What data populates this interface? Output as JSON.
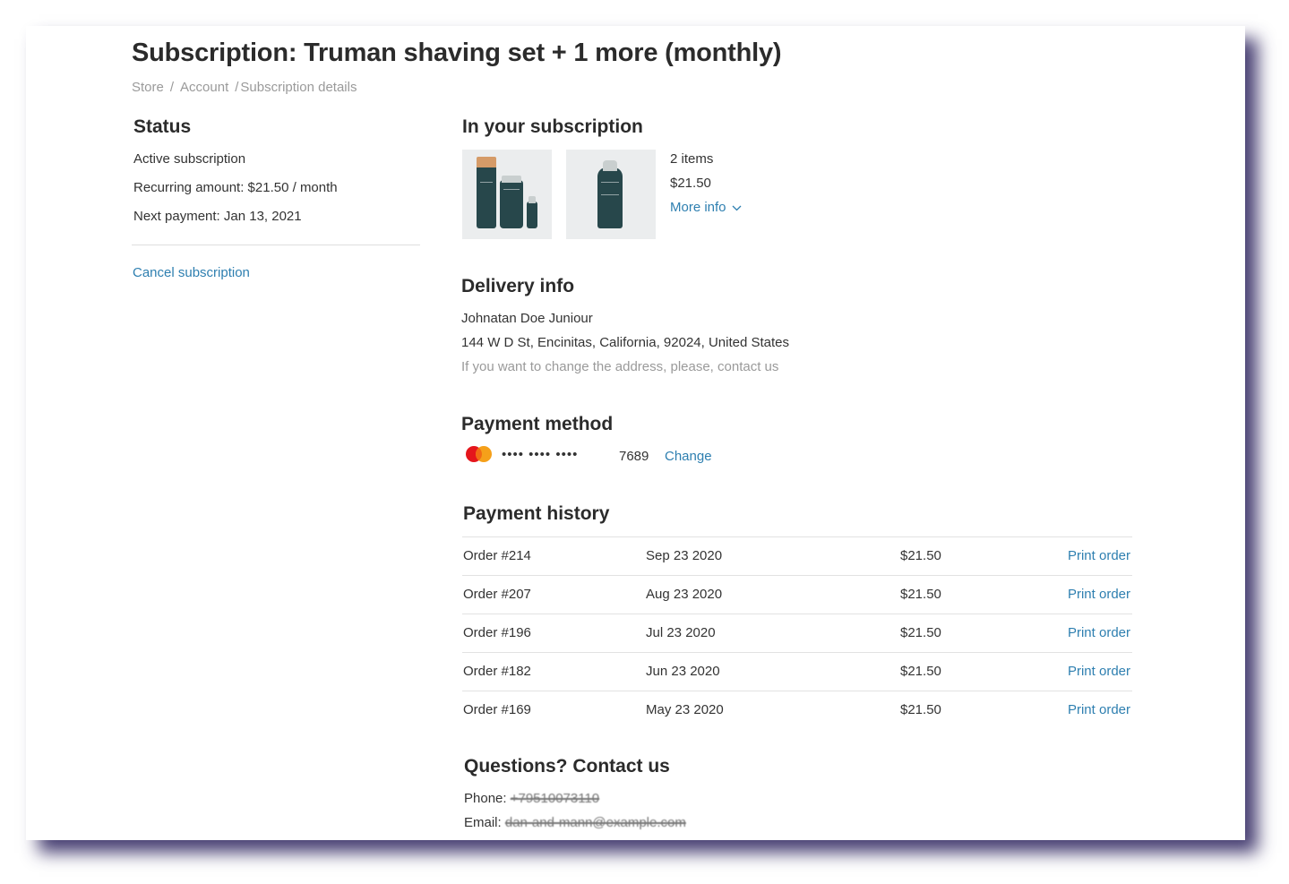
{
  "page": {
    "title": "Subscription: Truman shaving set + 1 more (monthly)",
    "breadcrumb": [
      "Store",
      "Account",
      "Subscription details"
    ],
    "breadcrumb_separator": "/"
  },
  "status": {
    "title": "Status",
    "state": "Active subscription",
    "recurring": "Recurring amount: $21.50 / month",
    "next_payment": "Next payment: Jan 13, 2021",
    "cancel_label": "Cancel subscription"
  },
  "subscription": {
    "title": "In your subscription",
    "products": [
      {
        "name": "shaving-set-image"
      },
      {
        "name": "shave-gel-image"
      }
    ],
    "item_count": "2 items",
    "price": "$21.50",
    "more_info_label": "More info"
  },
  "delivery": {
    "title": "Delivery info",
    "name": "Johnatan Doe Juniour",
    "address": "144 W D St, Encinitas, California, 92024, United States",
    "note": "If you want to change the address, please, contact us"
  },
  "payment_method": {
    "title": "Payment method",
    "card_brand_icon": "mastercard-icon",
    "masked": "•••• •••• ••••",
    "last4": "7689",
    "change_label": "Change"
  },
  "payment_history": {
    "title": "Payment history",
    "rows": [
      {
        "order": "Order #214",
        "date": "Sep 23 2020",
        "amount": "$21.50",
        "action": "Print order"
      },
      {
        "order": "Order #207",
        "date": "Aug 23 2020",
        "amount": "$21.50",
        "action": "Print order"
      },
      {
        "order": "Order #196",
        "date": "Jul 23 2020",
        "amount": "$21.50",
        "action": "Print order"
      },
      {
        "order": "Order #182",
        "date": "Jun 23 2020",
        "amount": "$21.50",
        "action": "Print order"
      },
      {
        "order": "Order #169",
        "date": "May 23 2020",
        "amount": "$21.50",
        "action": "Print order"
      }
    ]
  },
  "contact": {
    "title": "Questions? Contact us",
    "phone_label": "Phone:",
    "phone_value": "+79510073110",
    "email_label": "Email:",
    "email_value": "dan-and-mann@example.com"
  },
  "colors": {
    "link": "#2e7fb0",
    "text": "#333333",
    "muted": "#9a9a9a",
    "bottle": "#27474b"
  }
}
